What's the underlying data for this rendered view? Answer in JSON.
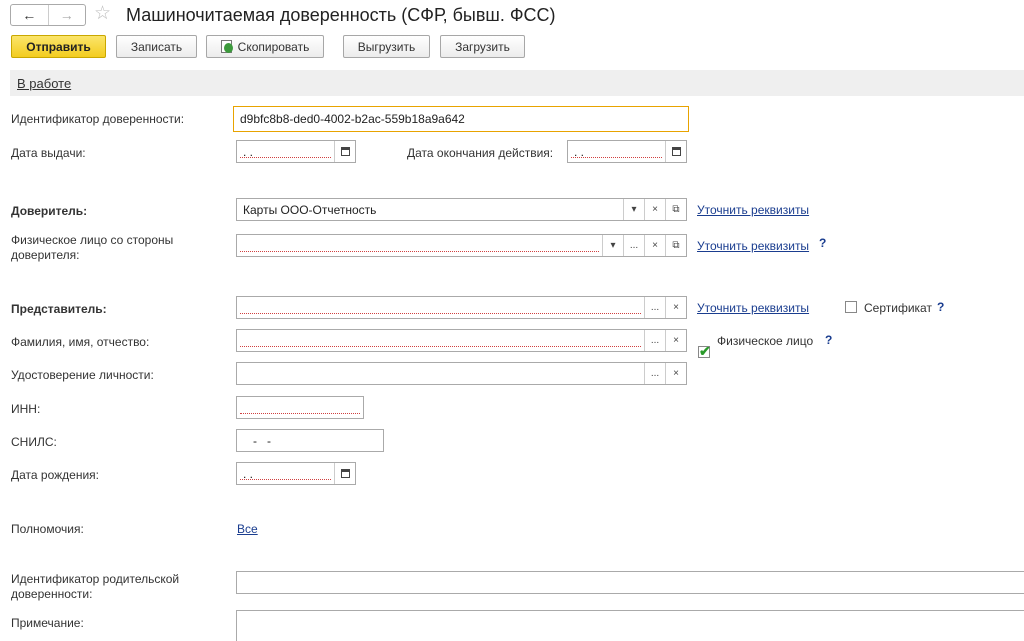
{
  "header": {
    "back_icon": "←",
    "forward_icon": "→",
    "star_icon": "☆",
    "title": "Машиночитаемая доверенность (СФР, бывш. ФСС)"
  },
  "toolbar": {
    "send": "Отправить",
    "save": "Записать",
    "copy": "Скопировать",
    "export": "Выгрузить",
    "import": "Загрузить"
  },
  "status": {
    "label": "В работе"
  },
  "form": {
    "id_label": "Идентификатор доверенности:",
    "id_value": "d9bfc8b8-ded0-4002-b2ac-559b18a9a642",
    "issue_date_label": "Дата выдачи:",
    "issue_date_value": "  .  .",
    "end_date_label": "Дата окончания действия:",
    "end_date_value": "  .  .",
    "principal_label": "Доверитель:",
    "principal_value": "Карты ООО-Отчетность",
    "refine": "Уточнить реквизиты",
    "person_label_1": "Физическое лицо со стороны",
    "person_label_2": "доверителя:",
    "question": "?",
    "rep_label": "Представитель:",
    "certificate_label": "Сертификат",
    "fio_label": "Фамилия, имя, отчество:",
    "individual_label": "Физическое лицо",
    "identity_label": "Удостоверение личности:",
    "inn_label": "ИНН:",
    "snils_label": "СНИЛС:",
    "snils_value": "   -   -",
    "birth_label": "Дата рождения:",
    "birth_value": "  .  .",
    "powers_label": "Полномочия:",
    "powers_value": "Все",
    "parent_label_1": "Идентификатор родительской",
    "parent_label_2": "доверенности:",
    "note_label": "Примечание:"
  },
  "glyphs": {
    "dropdown": "▾",
    "more": "...",
    "clear": "×",
    "open": "⧉"
  },
  "colors": {
    "primary": "#f3cc1f",
    "link": "#1a3d8f",
    "focus": "#e8a300",
    "check": "#2a9a2a"
  }
}
